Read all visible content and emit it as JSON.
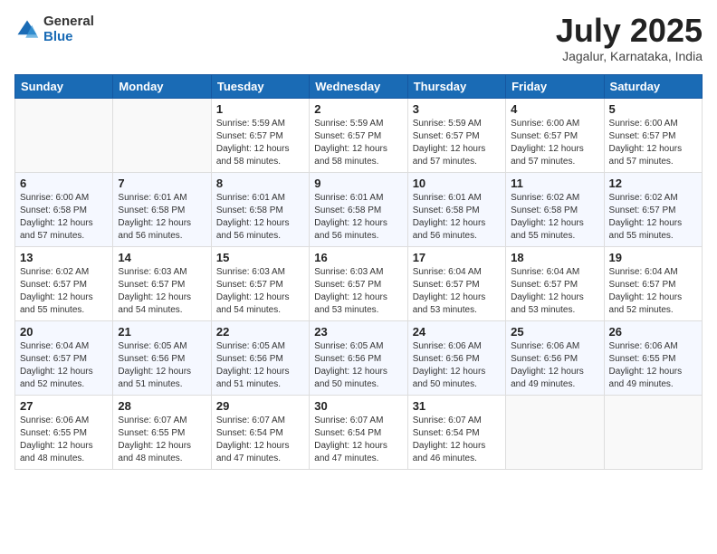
{
  "logo": {
    "general": "General",
    "blue": "Blue"
  },
  "title": "July 2025",
  "subtitle": "Jagalur, Karnataka, India",
  "weekdays": [
    "Sunday",
    "Monday",
    "Tuesday",
    "Wednesday",
    "Thursday",
    "Friday",
    "Saturday"
  ],
  "weeks": [
    [
      {
        "day": "",
        "sunrise": "",
        "sunset": "",
        "daylight": ""
      },
      {
        "day": "",
        "sunrise": "",
        "sunset": "",
        "daylight": ""
      },
      {
        "day": "1",
        "sunrise": "Sunrise: 5:59 AM",
        "sunset": "Sunset: 6:57 PM",
        "daylight": "Daylight: 12 hours and 58 minutes."
      },
      {
        "day": "2",
        "sunrise": "Sunrise: 5:59 AM",
        "sunset": "Sunset: 6:57 PM",
        "daylight": "Daylight: 12 hours and 58 minutes."
      },
      {
        "day": "3",
        "sunrise": "Sunrise: 5:59 AM",
        "sunset": "Sunset: 6:57 PM",
        "daylight": "Daylight: 12 hours and 57 minutes."
      },
      {
        "day": "4",
        "sunrise": "Sunrise: 6:00 AM",
        "sunset": "Sunset: 6:57 PM",
        "daylight": "Daylight: 12 hours and 57 minutes."
      },
      {
        "day": "5",
        "sunrise": "Sunrise: 6:00 AM",
        "sunset": "Sunset: 6:57 PM",
        "daylight": "Daylight: 12 hours and 57 minutes."
      }
    ],
    [
      {
        "day": "6",
        "sunrise": "Sunrise: 6:00 AM",
        "sunset": "Sunset: 6:58 PM",
        "daylight": "Daylight: 12 hours and 57 minutes."
      },
      {
        "day": "7",
        "sunrise": "Sunrise: 6:01 AM",
        "sunset": "Sunset: 6:58 PM",
        "daylight": "Daylight: 12 hours and 56 minutes."
      },
      {
        "day": "8",
        "sunrise": "Sunrise: 6:01 AM",
        "sunset": "Sunset: 6:58 PM",
        "daylight": "Daylight: 12 hours and 56 minutes."
      },
      {
        "day": "9",
        "sunrise": "Sunrise: 6:01 AM",
        "sunset": "Sunset: 6:58 PM",
        "daylight": "Daylight: 12 hours and 56 minutes."
      },
      {
        "day": "10",
        "sunrise": "Sunrise: 6:01 AM",
        "sunset": "Sunset: 6:58 PM",
        "daylight": "Daylight: 12 hours and 56 minutes."
      },
      {
        "day": "11",
        "sunrise": "Sunrise: 6:02 AM",
        "sunset": "Sunset: 6:58 PM",
        "daylight": "Daylight: 12 hours and 55 minutes."
      },
      {
        "day": "12",
        "sunrise": "Sunrise: 6:02 AM",
        "sunset": "Sunset: 6:57 PM",
        "daylight": "Daylight: 12 hours and 55 minutes."
      }
    ],
    [
      {
        "day": "13",
        "sunrise": "Sunrise: 6:02 AM",
        "sunset": "Sunset: 6:57 PM",
        "daylight": "Daylight: 12 hours and 55 minutes."
      },
      {
        "day": "14",
        "sunrise": "Sunrise: 6:03 AM",
        "sunset": "Sunset: 6:57 PM",
        "daylight": "Daylight: 12 hours and 54 minutes."
      },
      {
        "day": "15",
        "sunrise": "Sunrise: 6:03 AM",
        "sunset": "Sunset: 6:57 PM",
        "daylight": "Daylight: 12 hours and 54 minutes."
      },
      {
        "day": "16",
        "sunrise": "Sunrise: 6:03 AM",
        "sunset": "Sunset: 6:57 PM",
        "daylight": "Daylight: 12 hours and 53 minutes."
      },
      {
        "day": "17",
        "sunrise": "Sunrise: 6:04 AM",
        "sunset": "Sunset: 6:57 PM",
        "daylight": "Daylight: 12 hours and 53 minutes."
      },
      {
        "day": "18",
        "sunrise": "Sunrise: 6:04 AM",
        "sunset": "Sunset: 6:57 PM",
        "daylight": "Daylight: 12 hours and 53 minutes."
      },
      {
        "day": "19",
        "sunrise": "Sunrise: 6:04 AM",
        "sunset": "Sunset: 6:57 PM",
        "daylight": "Daylight: 12 hours and 52 minutes."
      }
    ],
    [
      {
        "day": "20",
        "sunrise": "Sunrise: 6:04 AM",
        "sunset": "Sunset: 6:57 PM",
        "daylight": "Daylight: 12 hours and 52 minutes."
      },
      {
        "day": "21",
        "sunrise": "Sunrise: 6:05 AM",
        "sunset": "Sunset: 6:56 PM",
        "daylight": "Daylight: 12 hours and 51 minutes."
      },
      {
        "day": "22",
        "sunrise": "Sunrise: 6:05 AM",
        "sunset": "Sunset: 6:56 PM",
        "daylight": "Daylight: 12 hours and 51 minutes."
      },
      {
        "day": "23",
        "sunrise": "Sunrise: 6:05 AM",
        "sunset": "Sunset: 6:56 PM",
        "daylight": "Daylight: 12 hours and 50 minutes."
      },
      {
        "day": "24",
        "sunrise": "Sunrise: 6:06 AM",
        "sunset": "Sunset: 6:56 PM",
        "daylight": "Daylight: 12 hours and 50 minutes."
      },
      {
        "day": "25",
        "sunrise": "Sunrise: 6:06 AM",
        "sunset": "Sunset: 6:56 PM",
        "daylight": "Daylight: 12 hours and 49 minutes."
      },
      {
        "day": "26",
        "sunrise": "Sunrise: 6:06 AM",
        "sunset": "Sunset: 6:55 PM",
        "daylight": "Daylight: 12 hours and 49 minutes."
      }
    ],
    [
      {
        "day": "27",
        "sunrise": "Sunrise: 6:06 AM",
        "sunset": "Sunset: 6:55 PM",
        "daylight": "Daylight: 12 hours and 48 minutes."
      },
      {
        "day": "28",
        "sunrise": "Sunrise: 6:07 AM",
        "sunset": "Sunset: 6:55 PM",
        "daylight": "Daylight: 12 hours and 48 minutes."
      },
      {
        "day": "29",
        "sunrise": "Sunrise: 6:07 AM",
        "sunset": "Sunset: 6:54 PM",
        "daylight": "Daylight: 12 hours and 47 minutes."
      },
      {
        "day": "30",
        "sunrise": "Sunrise: 6:07 AM",
        "sunset": "Sunset: 6:54 PM",
        "daylight": "Daylight: 12 hours and 47 minutes."
      },
      {
        "day": "31",
        "sunrise": "Sunrise: 6:07 AM",
        "sunset": "Sunset: 6:54 PM",
        "daylight": "Daylight: 12 hours and 46 minutes."
      },
      {
        "day": "",
        "sunrise": "",
        "sunset": "",
        "daylight": ""
      },
      {
        "day": "",
        "sunrise": "",
        "sunset": "",
        "daylight": ""
      }
    ]
  ]
}
